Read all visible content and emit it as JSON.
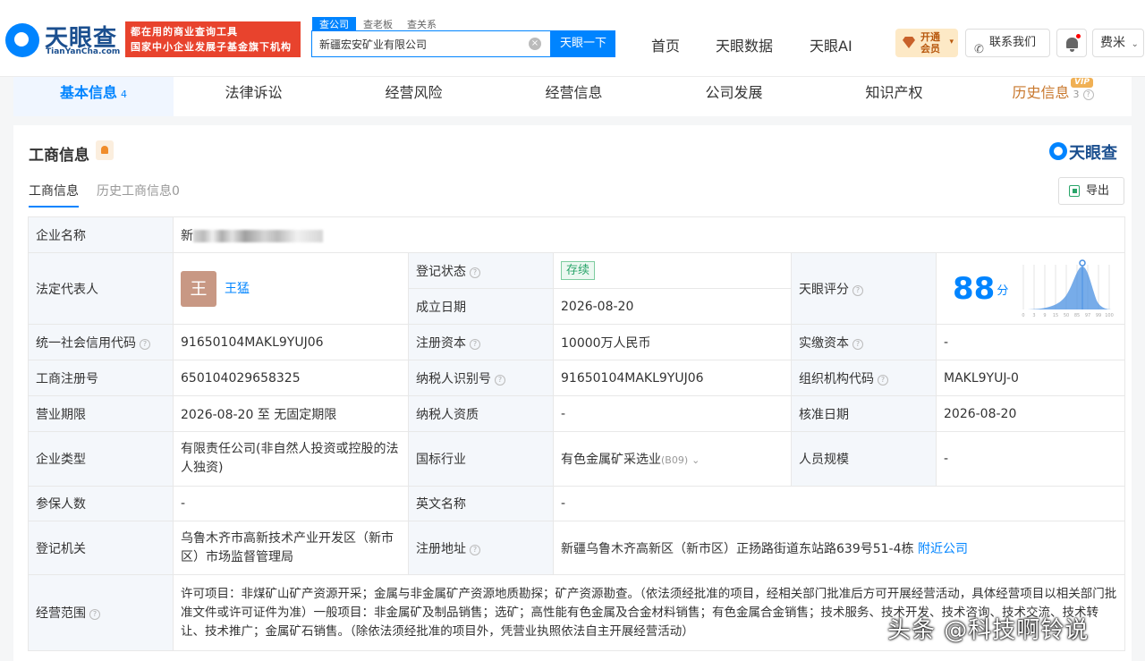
{
  "brand": {
    "name": "天眼查",
    "domain": "TianYanCha.com",
    "promo_line1": "都在用的商业查询工具",
    "promo_line2": "国家中小企业发展子基金旗下机构"
  },
  "search": {
    "tabs": [
      "查公司",
      "查老板",
      "查关系"
    ],
    "value": "新疆宏安矿业有限公司",
    "button": "天眼一下"
  },
  "nav": [
    "首页",
    "天眼数据",
    "天眼AI"
  ],
  "vip_button": {
    "line1": "开通",
    "line2": "会员"
  },
  "contact": "联系我们",
  "user": "费米",
  "main_tabs": [
    {
      "label": "基本信息",
      "count": "4"
    },
    {
      "label": "法律诉讼",
      "count": ""
    },
    {
      "label": "经营风险",
      "count": ""
    },
    {
      "label": "经营信息",
      "count": ""
    },
    {
      "label": "公司发展",
      "count": ""
    },
    {
      "label": "知识产权",
      "count": ""
    },
    {
      "label": "历史信息",
      "count": "3"
    }
  ],
  "vip_tag": "VIP",
  "section": {
    "title": "工商信息",
    "brand": "天眼查",
    "subtabs": [
      "工商信息",
      "历史工商信息0"
    ],
    "export": "导出"
  },
  "info": {
    "company_name_label": "企业名称",
    "company_name_visible": "新",
    "legal_rep_label": "法定代表人",
    "legal_rep_avatar": "王",
    "legal_rep_name": "王猛",
    "reg_status_label": "登记状态",
    "reg_status": "存续",
    "established_label": "成立日期",
    "established": "2026-08-20",
    "score_label": "天眼评分",
    "score": "88",
    "score_unit": "分",
    "score_axis": [
      "0",
      "3",
      "9",
      "15",
      "50",
      "85",
      "97",
      "99",
      "100"
    ],
    "credit_code_label": "统一社会信用代码",
    "credit_code": "91650104MAKL9YUJ06",
    "reg_capital_label": "注册资本",
    "reg_capital": "10000万人民币",
    "paid_capital_label": "实缴资本",
    "paid_capital": "-",
    "reg_no_label": "工商注册号",
    "reg_no": "650104029658325",
    "taxpayer_id_label": "纳税人识别号",
    "taxpayer_id": "91650104MAKL9YUJ06",
    "org_code_label": "组织机构代码",
    "org_code": "MAKL9YUJ-0",
    "term_label": "营业期限",
    "term": "2026-08-20 至 无固定期限",
    "taxpayer_qual_label": "纳税人资质",
    "taxpayer_qual": "-",
    "approval_date_label": "核准日期",
    "approval_date": "2026-08-20",
    "company_type_label": "企业类型",
    "company_type": "有限责任公司(非自然人投资或控股的法人独资)",
    "industry_label": "国标行业",
    "industry": "有色金属矿采选业",
    "industry_code": "(B09)",
    "staff_size_label": "人员规模",
    "staff_size": "-",
    "insured_label": "参保人数",
    "insured": "-",
    "english_name_label": "英文名称",
    "english_name": "-",
    "authority_label": "登记机关",
    "authority": "乌鲁木齐市高新技术产业开发区（新市区）市场监督管理局",
    "address_label": "注册地址",
    "address": "新疆乌鲁木齐高新区（新市区）正扬路街道东站路639号51-4栋",
    "nearby": "附近公司",
    "scope_label": "经营范围",
    "scope": "许可项目：非煤矿山矿产资源开采；金属与非金属矿产资源地质勘探；矿产资源勘查。（依法须经批准的项目，经相关部门批准后方可开展经营活动，具体经营项目以相关部门批准文件或许可证件为准）一般项目：非金属矿及制品销售；选矿；高性能有色金属及合金材料销售；有色金属合金销售；技术服务、技术开发、技术咨询、技术交流、技术转让、技术推广；金属矿石销售。（除依法须经批准的项目外，凭营业执照依法自主开展经营活动）"
  },
  "watermark": "头条 @科技啊铃说"
}
